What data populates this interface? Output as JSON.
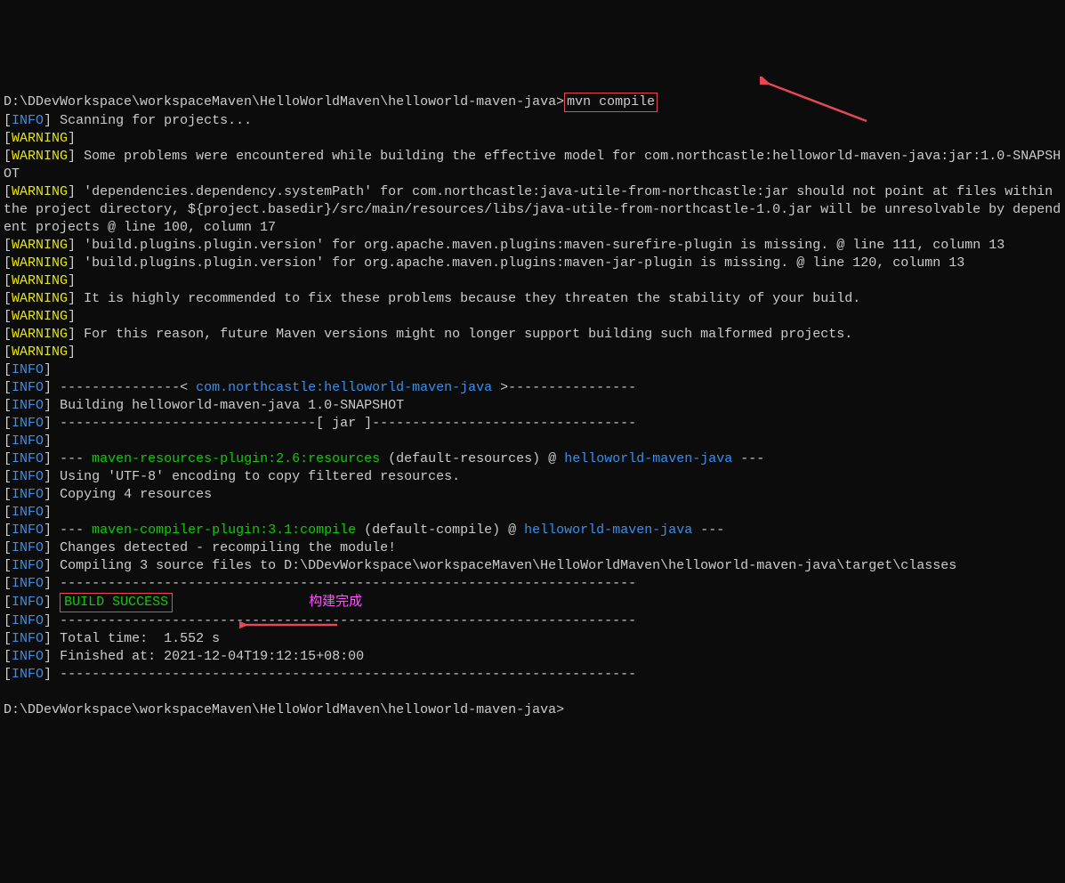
{
  "prompt1": "D:\\DDevWorkspace\\workspaceMaven\\HelloWorldMaven\\helloworld-maven-java>",
  "command": "mvn compile",
  "scan": "Scanning for projects...",
  "w_some": "Some problems were encountered while building the effective model for com.northcastle:helloworld-maven-java:jar:1.0-SNAPSHOT",
  "w_dep1": "'dependencies.dependency.systemPath' for com.northcastle:java-utile-from-northcastle:jar should not point at files within the project directory, ${project.basedir}/src/main/resources/libs/java-utile-from-northcastle-1.0.jar will be unresolvable by dependent projects @ line 100, column 17",
  "w_dep2": "'build.plugins.plugin.version' for org.apache.maven.plugins:maven-surefire-plugin is missing. @ line 111, column 13",
  "w_dep3": "'build.plugins.plugin.version' for org.apache.maven.plugins:maven-jar-plugin is missing. @ line 120, column 13",
  "w_rec": "It is highly recommended to fix these problems because they threaten the stability of your build.",
  "w_reason": "For this reason, future Maven versions might no longer support building such malformed projects.",
  "dash_pre": "---------------< ",
  "artifact": "com.northcastle:helloworld-maven-java",
  "dash_post": " >----------------",
  "building": "Building helloworld-maven-java 1.0-SNAPSHOT",
  "jarline": "--------------------------------[ jar ]---------------------------------",
  "dashes3": "--- ",
  "res_plugin": "maven-resources-plugin:2.6:resources",
  "res_suffix1": " (default-resources) @ ",
  "proj_name": "helloworld-maven-java",
  "dash_end": " ---",
  "utf8": "Using 'UTF-8' encoding to copy filtered resources.",
  "copy4": "Copying 4 resources",
  "comp_plugin": "maven-compiler-plugin:3.1:compile",
  "comp_suffix1": " (default-compile) @ ",
  "changes": "Changes detected - recompiling the module!",
  "compiling": "Compiling 3 source files to D:\\DDevWorkspace\\workspaceMaven\\HelloWorldMaven\\helloworld-maven-java\\target\\classes",
  "hr": "------------------------------------------------------------------------",
  "build_success": "BUILD SUCCESS",
  "annotation_done": "构建完成",
  "total_time": "Total time:  1.552 s",
  "finished": "Finished at: 2021-12-04T19:12:15+08:00",
  "prompt2": "D:\\DDevWorkspace\\workspaceMaven\\HelloWorldMaven\\helloworld-maven-java>",
  "lb": "[",
  "rb": "]",
  "INFO": "INFO",
  "WARNING": "WARNING"
}
